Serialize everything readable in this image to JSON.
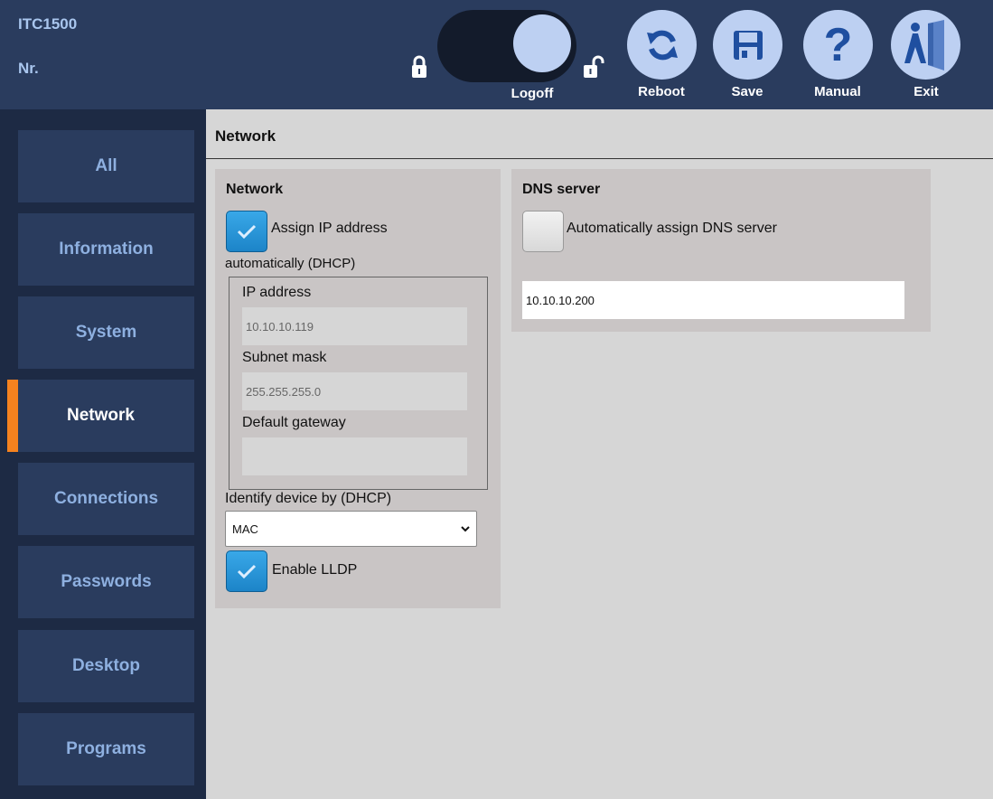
{
  "header": {
    "device_name": "ITC1500",
    "device_nr_label": "Nr.",
    "buttons": {
      "logoff": "Logoff",
      "reboot": "Reboot",
      "save": "Save",
      "manual": "Manual",
      "exit": "Exit"
    },
    "manual_glyph": "?"
  },
  "sidebar": {
    "items": [
      {
        "label": "All"
      },
      {
        "label": "Information"
      },
      {
        "label": "System"
      },
      {
        "label": "Network",
        "active": true
      },
      {
        "label": "Connections"
      },
      {
        "label": "Passwords"
      },
      {
        "label": "Desktop"
      },
      {
        "label": "Programs"
      }
    ]
  },
  "main": {
    "page_title": "Network",
    "network_panel": {
      "title": "Network",
      "dhcp_label_line1": "Assign IP address",
      "dhcp_label_line2": "automatically (DHCP)",
      "dhcp_checked": true,
      "ip_label": "IP address",
      "ip_value": "10.10.10.119",
      "subnet_label": "Subnet mask",
      "subnet_value": "255.255.255.0",
      "gateway_label": "Default gateway",
      "gateway_value": "",
      "identify_label": "Identify device by (DHCP)",
      "identify_selected": "MAC",
      "lldp_label": "Enable LLDP",
      "lldp_checked": true
    },
    "dns_panel": {
      "title": "DNS server",
      "auto_dns_label": "Automatically assign DNS server",
      "auto_dns_checked": false,
      "dns_value": "10.10.10.200"
    }
  },
  "colors": {
    "header_bg": "#2a3c5e",
    "sidebar_bg": "#1d2a44",
    "accent": "#f5821f",
    "button_circle": "#bdd0f2",
    "icon_blue": "#1f4fa0",
    "checkbox_blue": "#2a95d8"
  }
}
